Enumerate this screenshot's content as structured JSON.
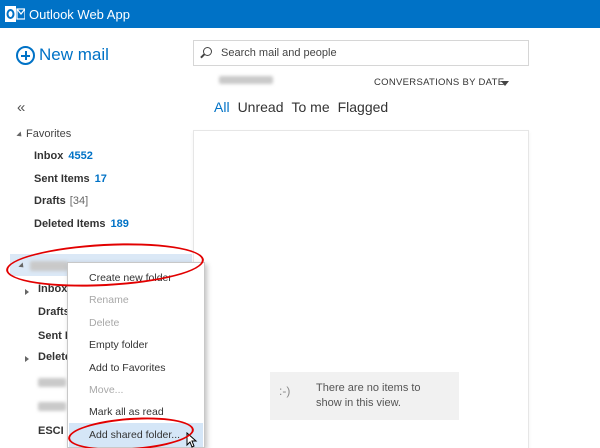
{
  "app": {
    "title": "Outlook Web App",
    "brand_color": "#0072c6"
  },
  "nav": {
    "new_mail_label": "New mail",
    "collapse_glyph": "«",
    "favorites_label": "Favorites",
    "favorites": [
      {
        "label": "Inbox",
        "count": "4552"
      },
      {
        "label": "Sent Items",
        "count": "17"
      },
      {
        "label": "Drafts",
        "count_muted": "[34]"
      },
      {
        "label": "Deleted Items",
        "count": "189"
      }
    ],
    "account_folders": [
      {
        "label": "Inbox"
      },
      {
        "label": "Drafts"
      },
      {
        "label": "Sent It"
      },
      {
        "label": "Delete"
      },
      {
        "label": "ESCI"
      }
    ]
  },
  "search": {
    "placeholder": "Search mail and people"
  },
  "list": {
    "sort_label": "CONVERSATIONS BY DATE",
    "filters": [
      "All",
      "Unread",
      "To me",
      "Flagged"
    ],
    "active_filter": "All",
    "empty_icon": ":-)",
    "empty_message": "There are no items to show in this view."
  },
  "context_menu": {
    "items": [
      {
        "label": "Create new folder",
        "enabled": true
      },
      {
        "label": "Rename",
        "enabled": false
      },
      {
        "label": "Delete",
        "enabled": false
      },
      {
        "label": "Empty folder",
        "enabled": true
      },
      {
        "label": "Add to Favorites",
        "enabled": true
      },
      {
        "label": "Move...",
        "enabled": false
      },
      {
        "label": "Mark all as read",
        "enabled": true
      },
      {
        "label": "Add shared folder...",
        "enabled": true,
        "highlighted": true
      }
    ]
  },
  "annotation_color": "#e20000"
}
